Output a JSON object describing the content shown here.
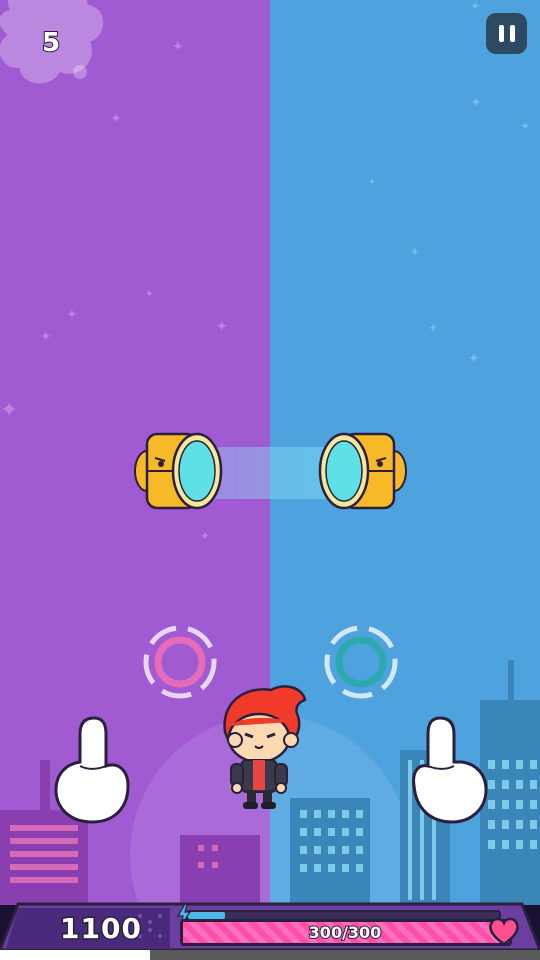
{
  "game": {
    "round": "5",
    "score": "1100",
    "health": {
      "text": "300/300",
      "current": 300,
      "max": 300
    },
    "energy_fraction": 0.12,
    "icons": {
      "pause": "pause-icon",
      "heart": "heart-icon",
      "energy": "lightning-bolt-icon"
    },
    "colors": {
      "left_lane": "#a05bd3",
      "right_lane": "#4ea3df",
      "left_target": "#e86bb8",
      "right_target": "#2ea8b0",
      "health": "#ff4fa8",
      "drum": "#f7b928",
      "drum_face": "#5ee0e6"
    }
  }
}
